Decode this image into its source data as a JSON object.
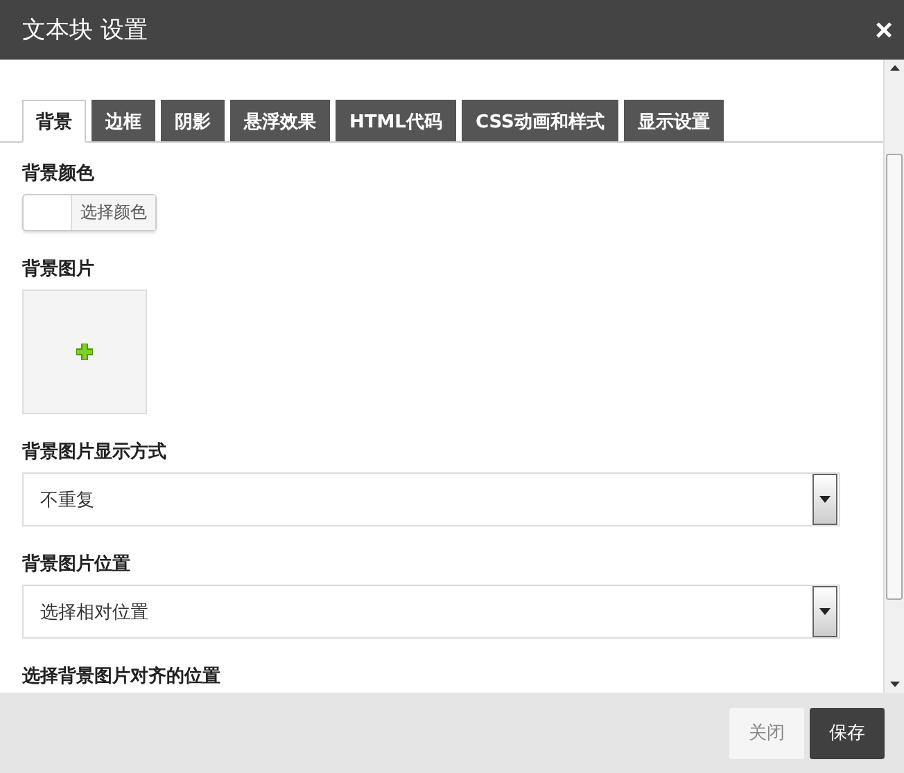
{
  "window": {
    "title": "文本块 设置",
    "close": "×"
  },
  "tabs": [
    {
      "label": "背景",
      "selected": true
    },
    {
      "label": "边框",
      "selected": false
    },
    {
      "label": "阴影",
      "selected": false
    },
    {
      "label": "悬浮效果",
      "selected": false
    },
    {
      "label": "HTML代码",
      "selected": false
    },
    {
      "label": "CSS动画和样式",
      "selected": false
    },
    {
      "label": "显示设置",
      "selected": false
    }
  ],
  "fields": [
    {
      "kind": "color",
      "label": "背景颜色",
      "button": "选择颜色"
    },
    {
      "kind": "image",
      "label": "背景图片"
    },
    {
      "kind": "select",
      "label": "背景图片显示方式",
      "value": "不重复"
    },
    {
      "kind": "select",
      "label": "背景图片位置",
      "value": "选择相对位置"
    },
    {
      "kind": "heading",
      "label": "选择背景图片对齐的位置"
    }
  ],
  "buttons": [
    {
      "label": "关闭",
      "kind": "secondary"
    },
    {
      "label": "保存",
      "kind": "primary"
    }
  ]
}
